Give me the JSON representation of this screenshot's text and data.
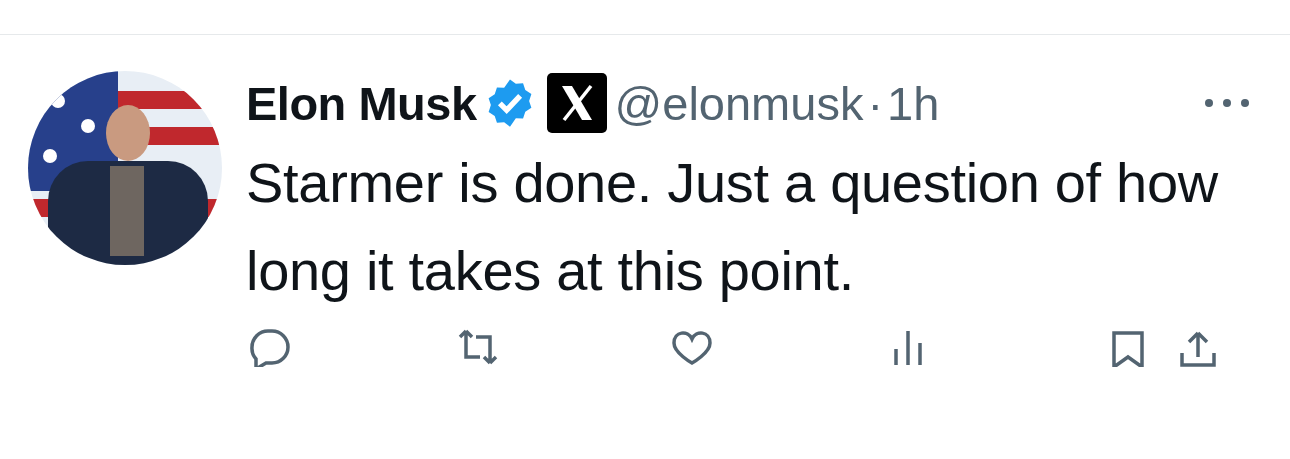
{
  "tweet": {
    "author": {
      "name": "Elon Musk",
      "verified": true,
      "affiliate_badge": true,
      "handle": "@elonmusk",
      "separator": "·",
      "time": "1h"
    },
    "text": "Starmer is done. Just a question of how long it takes at this point."
  }
}
